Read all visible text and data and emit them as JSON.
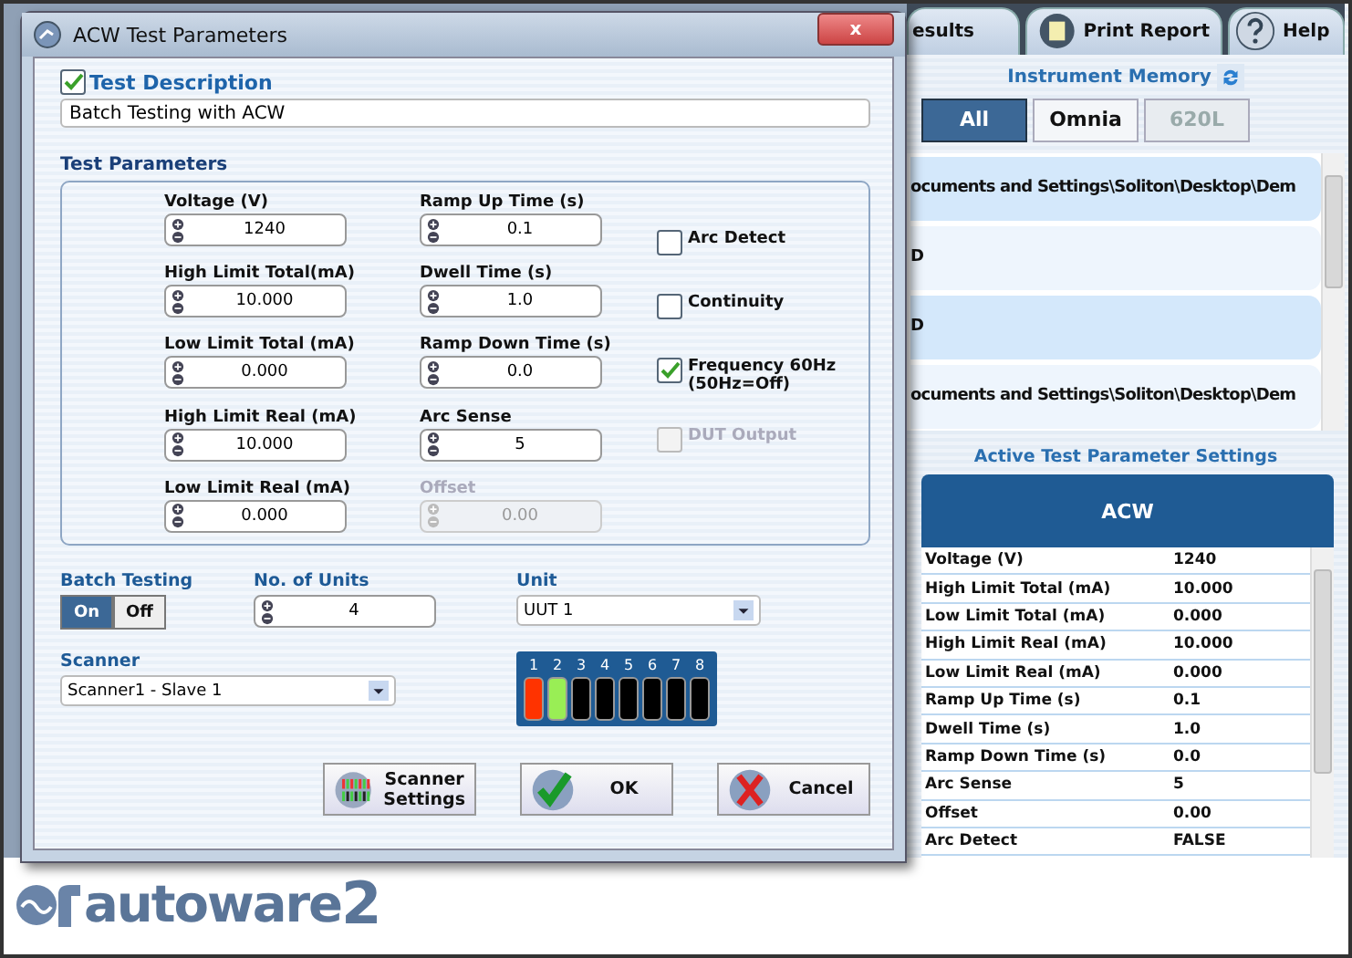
{
  "app": {
    "tabs": [
      {
        "label": "esults"
      },
      {
        "label": "Print Report"
      },
      {
        "label": "Help"
      }
    ],
    "memory": {
      "title": "Instrument Memory",
      "filters": [
        {
          "label": "All",
          "selected": true,
          "disabled": false
        },
        {
          "label": "Omnia",
          "selected": false,
          "disabled": false
        },
        {
          "label": "620L",
          "selected": false,
          "disabled": true
        }
      ],
      "items": [
        {
          "text": "ocuments and Settings\\Soliton\\Desktop\\Dem"
        },
        {
          "text": "D"
        },
        {
          "text": "D"
        },
        {
          "text": "ocuments and Settings\\Soliton\\Desktop\\Dem"
        }
      ]
    },
    "active": {
      "title": "Active Test Parameter Settings",
      "header": "ACW",
      "rows": [
        {
          "name": "Voltage (V)",
          "value": "1240"
        },
        {
          "name": "High Limit Total (mA)",
          "value": "10.000"
        },
        {
          "name": "Low Limit Total (mA)",
          "value": "0.000"
        },
        {
          "name": "High Limit Real (mA)",
          "value": "10.000"
        },
        {
          "name": "Low Limit Real (mA)",
          "value": "0.000"
        },
        {
          "name": "Ramp Up Time (s)",
          "value": "0.1"
        },
        {
          "name": "Dwell Time (s)",
          "value": "1.0"
        },
        {
          "name": "Ramp Down Time (s)",
          "value": "0.0"
        },
        {
          "name": "Arc Sense",
          "value": "5"
        },
        {
          "name": "Offset",
          "value": "0.00"
        },
        {
          "name": "Arc Detect",
          "value": "FALSE"
        }
      ]
    },
    "logo": {
      "text": "autoware",
      "suffix": "2"
    }
  },
  "dialog": {
    "title": "ACW Test Parameters",
    "close": "x",
    "description": {
      "label": "Test Description",
      "checked": true,
      "value": "Batch Testing with ACW"
    },
    "parameters": {
      "title": "Test Parameters",
      "fields": [
        {
          "label": "Voltage (V)",
          "value": "1240",
          "disabled": false
        },
        {
          "label": "Ramp Up Time (s)",
          "value": "0.1",
          "disabled": false
        },
        {
          "label": "High Limit Total(mA)",
          "value": "10.000",
          "disabled": false
        },
        {
          "label": "Dwell Time (s)",
          "value": "1.0",
          "disabled": false
        },
        {
          "label": "Low Limit Total (mA)",
          "value": "0.000",
          "disabled": false
        },
        {
          "label": "Ramp Down Time (s)",
          "value": "0.0",
          "disabled": false
        },
        {
          "label": "High Limit Real (mA)",
          "value": "10.000",
          "disabled": false
        },
        {
          "label": "Arc Sense",
          "value": "5",
          "disabled": false
        },
        {
          "label": "Low Limit Real (mA)",
          "value": "0.000",
          "disabled": false
        },
        {
          "label": "Offset",
          "value": "0.00",
          "disabled": true
        }
      ],
      "options": [
        {
          "lines": [
            "Arc Detect"
          ],
          "checked": false,
          "disabled": false
        },
        {
          "lines": [
            "Continuity"
          ],
          "checked": false,
          "disabled": false
        },
        {
          "lines": [
            "Frequency 60Hz",
            "(50Hz=Off)"
          ],
          "checked": true,
          "disabled": false
        },
        {
          "lines": [
            "DUT Output"
          ],
          "checked": false,
          "disabled": true
        }
      ]
    },
    "batch": {
      "label": "Batch Testing",
      "options": [
        {
          "label": "On",
          "selected": true
        },
        {
          "label": "Off",
          "selected": false
        }
      ]
    },
    "units": {
      "label": "No. of Units",
      "value": "4"
    },
    "unit": {
      "label": "Unit",
      "value": "UUT 1"
    },
    "scanner": {
      "label": "Scanner",
      "value": "Scanner1 - Slave 1"
    },
    "channels": [
      {
        "label": "1",
        "color": "#ff3300"
      },
      {
        "label": "2",
        "color": "#99ee55"
      },
      {
        "label": "3",
        "color": "#000000"
      },
      {
        "label": "4",
        "color": "#000000"
      },
      {
        "label": "5",
        "color": "#000000"
      },
      {
        "label": "6",
        "color": "#000000"
      },
      {
        "label": "7",
        "color": "#000000"
      },
      {
        "label": "8",
        "color": "#000000"
      }
    ],
    "buttons": [
      {
        "kind": "scanner",
        "lines": [
          "Scanner",
          "Settings"
        ]
      },
      {
        "kind": "ok",
        "lines": [
          "OK"
        ]
      },
      {
        "kind": "cancel",
        "lines": [
          "Cancel"
        ]
      }
    ]
  }
}
